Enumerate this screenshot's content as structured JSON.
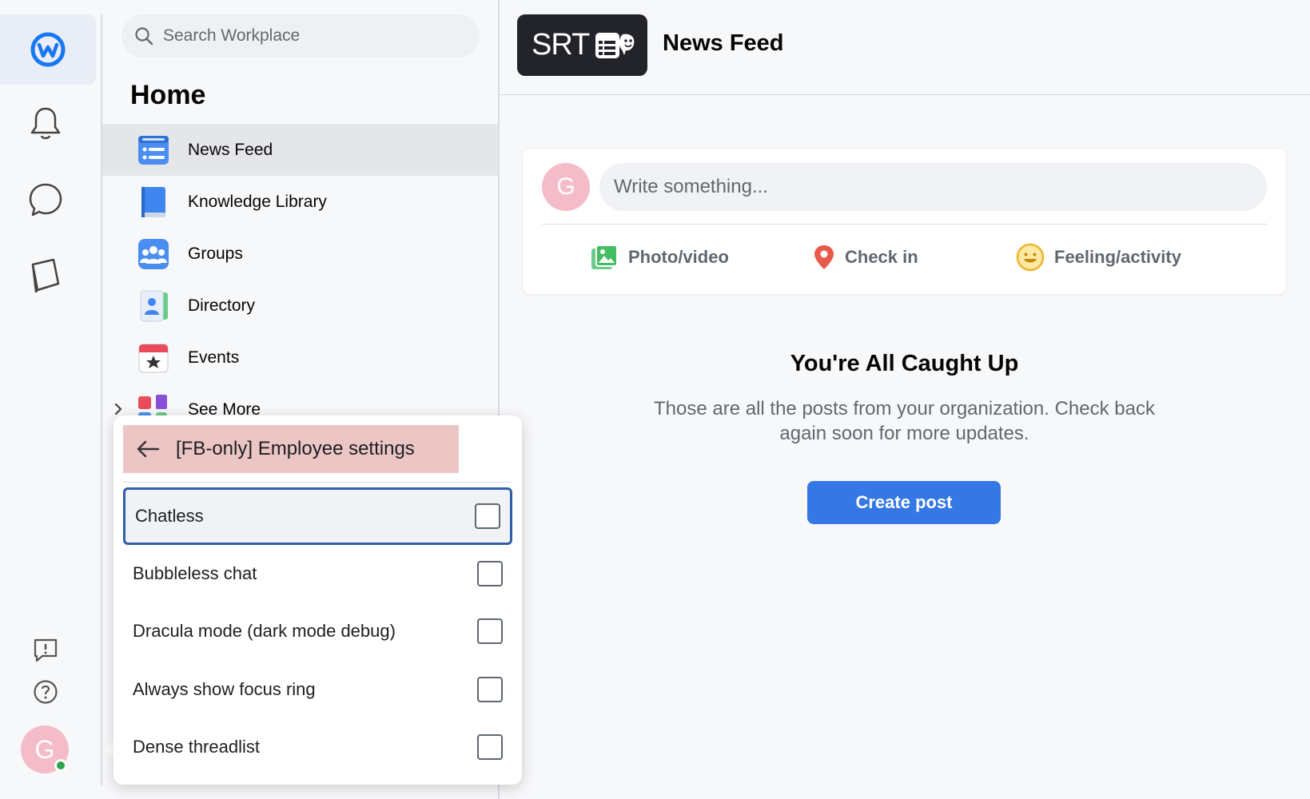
{
  "search": {
    "placeholder": "Search Workplace"
  },
  "sidebar": {
    "title": "Home",
    "items": [
      {
        "label": "News Feed",
        "icon": "news-feed-icon",
        "active": true
      },
      {
        "label": "Knowledge Library",
        "icon": "book-icon"
      },
      {
        "label": "Groups",
        "icon": "groups-icon"
      },
      {
        "label": "Directory",
        "icon": "directory-icon"
      },
      {
        "label": "Events",
        "icon": "calendar-star-icon"
      }
    ],
    "see_more": "See More"
  },
  "rail": {
    "avatar_initial": "G"
  },
  "popup": {
    "title": "[FB-only] Employee settings",
    "options": [
      {
        "label": "Chatless",
        "checked": false,
        "focused": true
      },
      {
        "label": "Bubbleless chat",
        "checked": false
      },
      {
        "label": "Dracula mode (dark mode debug)",
        "checked": false
      },
      {
        "label": "Always show focus ring",
        "checked": false
      },
      {
        "label": "Dense threadlist",
        "checked": false
      }
    ]
  },
  "topbar": {
    "logo_text": "SRT",
    "title": "News Feed"
  },
  "composer": {
    "avatar_initial": "G",
    "placeholder": "Write something...",
    "actions": [
      {
        "label": "Photo/video",
        "icon": "photo-icon"
      },
      {
        "label": "Check in",
        "icon": "location-pin-icon"
      },
      {
        "label": "Feeling/activity",
        "icon": "smiley-icon"
      }
    ]
  },
  "empty_state": {
    "title": "You're All Caught Up",
    "text": "Those are all the posts from your organization. Check back again soon for more updates.",
    "button": "Create post"
  },
  "colors": {
    "accent": "#3578e5",
    "popup_header": "#ecc5c5",
    "avatar": "#f3bcc8",
    "online": "#31a24c"
  }
}
